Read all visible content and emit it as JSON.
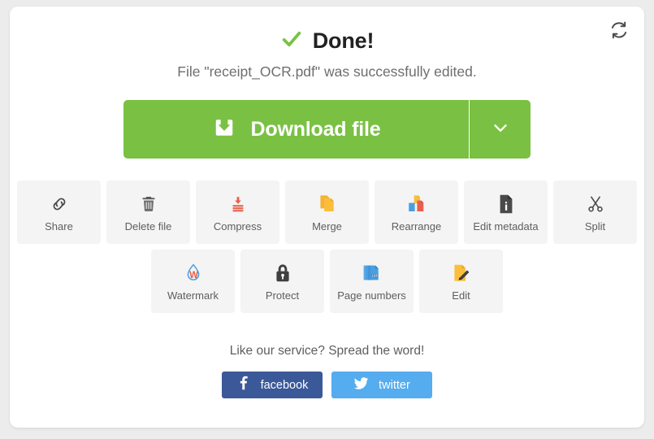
{
  "header": {
    "refresh_icon": "refresh-icon",
    "status_icon": "check-icon",
    "headline": "Done!",
    "subtitle": "File \"receipt_OCR.pdf\" was successfully edited."
  },
  "download": {
    "icon": "download-icon",
    "label": "Download file",
    "caret_icon": "chevron-down-icon"
  },
  "tools": {
    "row1": [
      {
        "label": "Share",
        "icon": "link-icon"
      },
      {
        "label": "Delete file",
        "icon": "trash-icon"
      },
      {
        "label": "Compress",
        "icon": "compress-icon"
      },
      {
        "label": "Merge",
        "icon": "merge-pages-icon"
      },
      {
        "label": "Rearrange",
        "icon": "rearrange-pages-icon"
      },
      {
        "label": "Edit metadata",
        "icon": "document-info-icon"
      },
      {
        "label": "Split",
        "icon": "scissors-icon"
      }
    ],
    "row2": [
      {
        "label": "Watermark",
        "icon": "watermark-droplet-icon"
      },
      {
        "label": "Protect",
        "icon": "lock-icon"
      },
      {
        "label": "Page numbers",
        "icon": "page-numbers-icon"
      },
      {
        "label": "Edit",
        "icon": "pencil-page-icon"
      }
    ]
  },
  "share": {
    "prompt": "Like our service? Spread the word!",
    "facebook_label": "facebook",
    "facebook_icon": "facebook-icon",
    "twitter_label": "twitter",
    "twitter_icon": "twitter-icon"
  },
  "colors": {
    "accent_green": "#7ac143",
    "facebook_blue": "#3b5998",
    "twitter_blue": "#55acee",
    "tile_background": "#f4f4f4",
    "page_background": "#ececec"
  }
}
